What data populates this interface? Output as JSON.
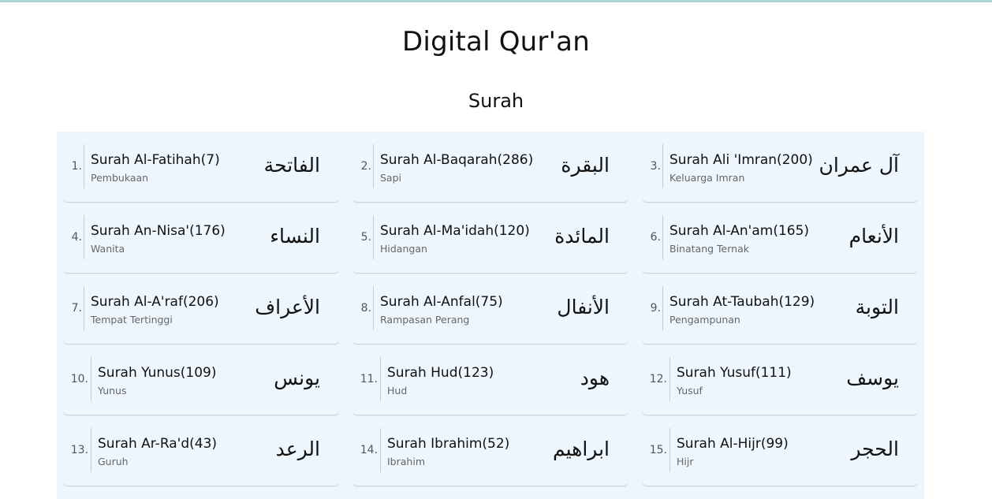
{
  "header": {
    "title": "Digital Qur'an",
    "section": "Surah"
  },
  "surahs": [
    {
      "num": "1.",
      "name": "Surah Al-Fatihah(7)",
      "meaning": "Pembukaan",
      "arabic": "الفاتحة"
    },
    {
      "num": "2.",
      "name": "Surah Al-Baqarah(286)",
      "meaning": "Sapi",
      "arabic": "البقرة"
    },
    {
      "num": "3.",
      "name": "Surah Ali 'Imran(200)",
      "meaning": "Keluarga Imran",
      "arabic": "آل عمران"
    },
    {
      "num": "4.",
      "name": "Surah An-Nisa'(176)",
      "meaning": "Wanita",
      "arabic": "النساء"
    },
    {
      "num": "5.",
      "name": "Surah Al-Ma'idah(120)",
      "meaning": "Hidangan",
      "arabic": "المائدة"
    },
    {
      "num": "6.",
      "name": "Surah Al-An'am(165)",
      "meaning": "Binatang Ternak",
      "arabic": "الأنعام"
    },
    {
      "num": "7.",
      "name": "Surah Al-A'raf(206)",
      "meaning": "Tempat Tertinggi",
      "arabic": "الأعراف"
    },
    {
      "num": "8.",
      "name": "Surah Al-Anfal(75)",
      "meaning": "Rampasan Perang",
      "arabic": "الأنفال"
    },
    {
      "num": "9.",
      "name": "Surah At-Taubah(129)",
      "meaning": "Pengampunan",
      "arabic": "التوبة"
    },
    {
      "num": "10.",
      "name": "Surah Yunus(109)",
      "meaning": "Yunus",
      "arabic": "يونس"
    },
    {
      "num": "11.",
      "name": "Surah Hud(123)",
      "meaning": "Hud",
      "arabic": "هود"
    },
    {
      "num": "12.",
      "name": "Surah Yusuf(111)",
      "meaning": "Yusuf",
      "arabic": "يوسف"
    },
    {
      "num": "13.",
      "name": "Surah Ar-Ra'd(43)",
      "meaning": "Guruh",
      "arabic": "الرعد"
    },
    {
      "num": "14.",
      "name": "Surah Ibrahim(52)",
      "meaning": "Ibrahim",
      "arabic": "ابراهيم"
    },
    {
      "num": "15.",
      "name": "Surah Al-Hijr(99)",
      "meaning": "Hijr",
      "arabic": "الحجر"
    }
  ]
}
